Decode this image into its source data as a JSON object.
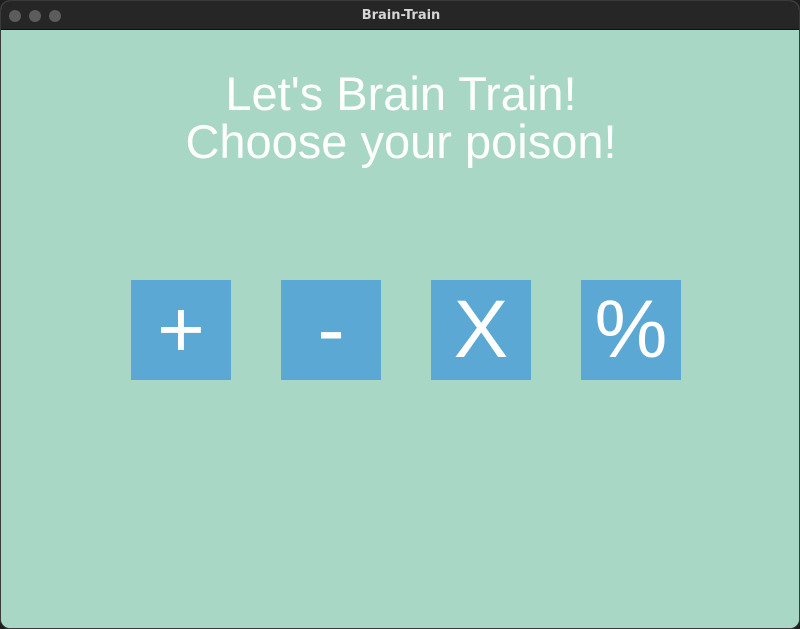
{
  "window": {
    "title": "Brain-Train"
  },
  "main": {
    "headline_line1": "Let's Brain Train!",
    "headline_line2": "Choose your poison!"
  },
  "operations": [
    {
      "label": "+"
    },
    {
      "label": "-"
    },
    {
      "label": "X"
    },
    {
      "label": "%"
    }
  ],
  "colors": {
    "background": "#a8d7c6",
    "button": "#5aa8d3",
    "text": "#ffffff",
    "titlebar": "#262626"
  }
}
